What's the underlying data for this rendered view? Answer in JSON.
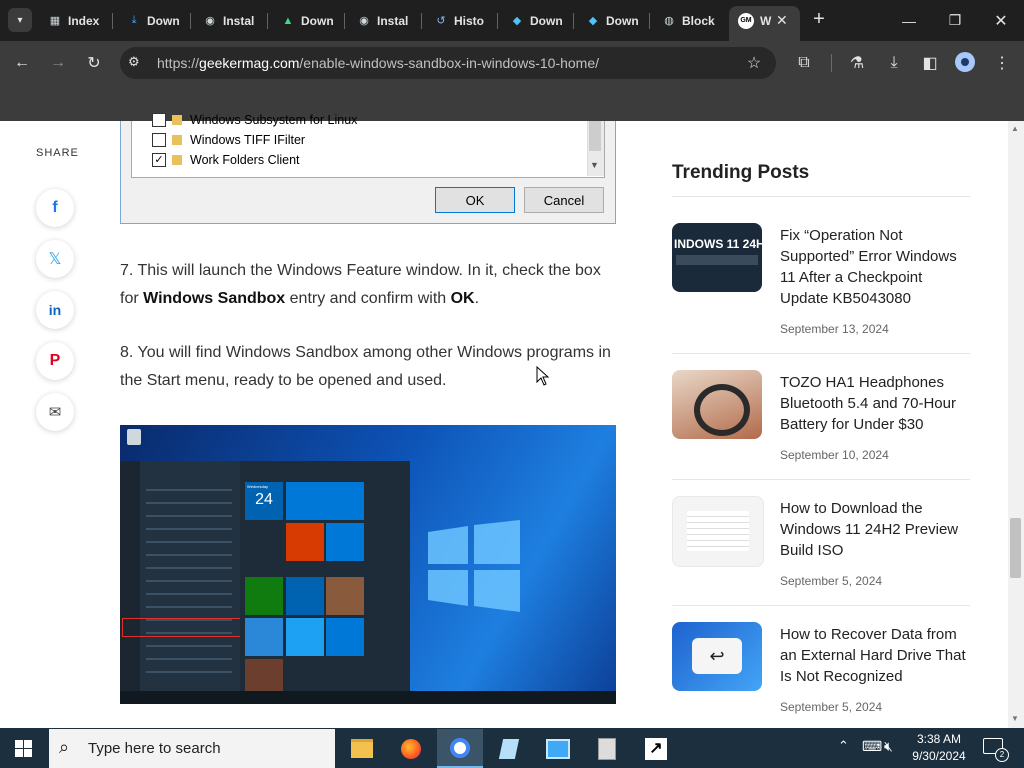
{
  "browser": {
    "tabs": [
      {
        "label": "Index",
        "icon": "book-icon"
      },
      {
        "label": "Down",
        "icon": "download-icon"
      },
      {
        "label": "Instal",
        "icon": "github-icon"
      },
      {
        "label": "Down",
        "icon": "android-icon"
      },
      {
        "label": "Instal",
        "icon": "github-icon"
      },
      {
        "label": "Histo",
        "icon": "history-icon"
      },
      {
        "label": "Down",
        "icon": "diamond-icon"
      },
      {
        "label": "Down",
        "icon": "diamond-icon"
      },
      {
        "label": "Block",
        "icon": "globe-icon"
      },
      {
        "label": "W",
        "icon": "gm-icon"
      }
    ],
    "url_prefix": "https://",
    "url_host": "geekermag.com",
    "url_path": "/enable-windows-sandbox-in-windows-10-home/"
  },
  "share": {
    "label": "SHARE"
  },
  "dialog": {
    "items": [
      {
        "label": "Windows Subsystem for Linux",
        "checked": false
      },
      {
        "label": "Windows TIFF IFilter",
        "checked": false
      },
      {
        "label": "Work Folders Client",
        "checked": true
      }
    ],
    "ok": "OK",
    "cancel": "Cancel"
  },
  "article": {
    "step7_a": "7. This will launch the Windows Feature window. In it, check the box for ",
    "step7_bold1": "Windows Sandbox",
    "step7_b": " entry and confirm with ",
    "step7_bold2": "OK",
    "step7_c": ".",
    "step8": "8. You will find Windows Sandbox among other Windows programs in the Start menu, ready to be opened and used.",
    "shot": {
      "date_day": "Wednesday",
      "date_num": "24"
    }
  },
  "sidebar": {
    "title": "Trending Posts",
    "posts": [
      {
        "title": "Fix “Operation Not Supported” Error Windows 11 After a Checkpoint Update KB5043080",
        "date": "September 13, 2024",
        "thumb_text": "INDOWS 11 24H"
      },
      {
        "title": "TOZO HA1 Headphones Bluetooth 5.4 and 70-Hour Battery for Under $30",
        "date": "September 10, 2024",
        "thumb_text": ""
      },
      {
        "title": "How to Download the Windows 11 24H2 Preview Build ISO",
        "date": "September 5, 2024",
        "thumb_text": ""
      },
      {
        "title": "How to Recover Data from an External Hard Drive That Is Not Recognized",
        "date": "September 5, 2024",
        "thumb_text": ""
      }
    ]
  },
  "taskbar": {
    "search_placeholder": "Type here to search",
    "time": "3:38 AM",
    "date": "9/30/2024",
    "notification_count": "2"
  }
}
